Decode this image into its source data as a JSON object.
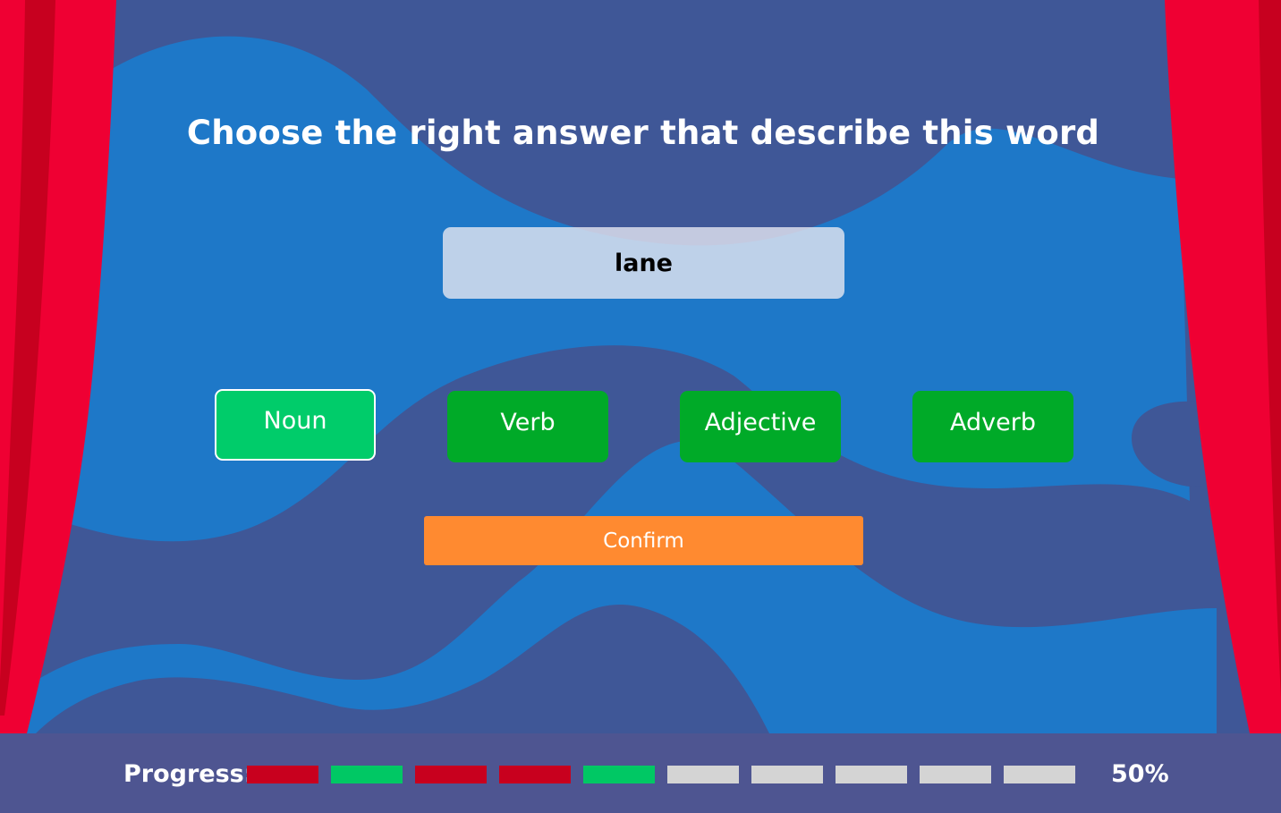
{
  "prompt": "Choose the right answer that describe this word",
  "word": "lane",
  "options": [
    {
      "label": "Noun",
      "selected": true
    },
    {
      "label": "Verb",
      "selected": false
    },
    {
      "label": "Adjective",
      "selected": false
    },
    {
      "label": "Adverb",
      "selected": false
    }
  ],
  "confirm_label": "Confirm",
  "progress": {
    "label": "Progress:",
    "segments": [
      "wrong",
      "correct",
      "wrong",
      "wrong",
      "correct",
      "pending",
      "pending",
      "pending",
      "pending",
      "pending"
    ],
    "percent_text": "50%",
    "fraction": 0.5
  },
  "colors": {
    "background_dark": "#3f5797",
    "background_light": "#1e78c8",
    "curtain": "#ef0033",
    "curtain_shadow": "#c7001f",
    "option": "#00aa28",
    "option_selected": "#00cc6a",
    "confirm": "#ff8a30",
    "progress_bar": "#4e5591",
    "segment_wrong": "#c8001e",
    "segment_correct": "#00c864",
    "segment_pending": "#d4d4d4"
  }
}
